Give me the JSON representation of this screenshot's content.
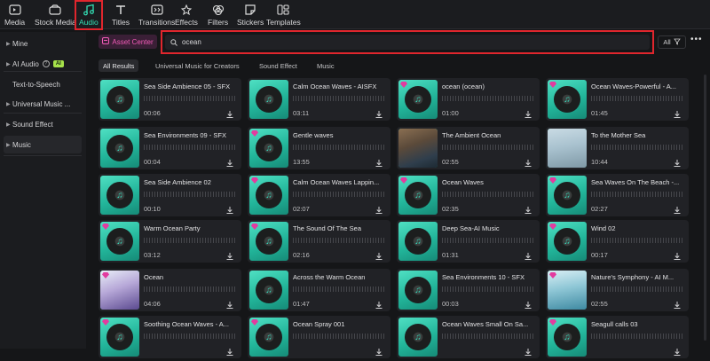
{
  "toolbar": {
    "items": [
      {
        "label": "Media",
        "icon": "media-icon"
      },
      {
        "label": "Stock Media",
        "icon": "stock-media-icon"
      },
      {
        "label": "Audio",
        "icon": "music-note-icon"
      },
      {
        "label": "Titles",
        "icon": "titles-icon"
      },
      {
        "label": "Transitions",
        "icon": "transitions-icon"
      },
      {
        "label": "Effects",
        "icon": "effects-icon"
      },
      {
        "label": "Filters",
        "icon": "filters-icon"
      },
      {
        "label": "Stickers",
        "icon": "stickers-icon"
      },
      {
        "label": "Templates",
        "icon": "templates-icon"
      }
    ],
    "active": "Audio"
  },
  "sidebar": {
    "items": [
      {
        "label": "Mine"
      },
      {
        "label": "AI Audio",
        "badge": "AI"
      },
      {
        "label": "Text-to-Speech"
      },
      {
        "label": "Universal Music ..."
      },
      {
        "label": "Sound Effect"
      },
      {
        "label": "Music"
      }
    ]
  },
  "search": {
    "asset_center": "Asset Center",
    "query": "ocean",
    "filter": "All"
  },
  "tabs": [
    "All Results",
    "Universal Music for Creators",
    "Sound Effect",
    "Music"
  ],
  "colors": {
    "accent": "#33e0b6",
    "highlight_box": "#e0262d",
    "premium_gem": "#e23b9f"
  },
  "results": [
    {
      "title": "Sea Side Ambience 05 - SFX",
      "duration": "00:06",
      "premium": false,
      "thumb": "vinyl"
    },
    {
      "title": "Calm Ocean Waves - AISFX",
      "duration": "03:11",
      "premium": false,
      "thumb": "vinyl"
    },
    {
      "title": "ocean (ocean)",
      "duration": "01:00",
      "premium": true,
      "thumb": "vinyl"
    },
    {
      "title": "Ocean Waves-Powerful - A...",
      "duration": "01:45",
      "premium": true,
      "thumb": "vinyl"
    },
    {
      "title": "Sea Environments 09 - SFX",
      "duration": "00:04",
      "premium": false,
      "thumb": "vinyl"
    },
    {
      "title": "Gentle waves",
      "duration": "13:55",
      "premium": true,
      "thumb": "vinyl"
    },
    {
      "title": "The Ambient Ocean",
      "duration": "02:55",
      "premium": false,
      "thumb": "rocks"
    },
    {
      "title": "To the Mother Sea",
      "duration": "10:44",
      "premium": false,
      "thumb": "shell"
    },
    {
      "title": "Sea Side Ambience 02",
      "duration": "00:10",
      "premium": false,
      "thumb": "vinyl"
    },
    {
      "title": "Calm Ocean Waves Lappin...",
      "duration": "02:07",
      "premium": true,
      "thumb": "vinyl"
    },
    {
      "title": "Ocean Waves",
      "duration": "02:35",
      "premium": true,
      "thumb": "vinyl"
    },
    {
      "title": "Sea Waves On The Beach -...",
      "duration": "02:27",
      "premium": true,
      "thumb": "vinyl"
    },
    {
      "title": "Warm Ocean Party",
      "duration": "03:12",
      "premium": true,
      "thumb": "vinyl"
    },
    {
      "title": "The Sound Of The Sea",
      "duration": "02:16",
      "premium": true,
      "thumb": "vinyl"
    },
    {
      "title": "Deep Sea-AI Music",
      "duration": "01:31",
      "premium": false,
      "thumb": "vinyl"
    },
    {
      "title": "Wind 02",
      "duration": "00:17",
      "premium": true,
      "thumb": "vinyl"
    },
    {
      "title": "Ocean",
      "duration": "04:06",
      "premium": true,
      "thumb": "album"
    },
    {
      "title": "Across the Warm Ocean",
      "duration": "01:47",
      "premium": false,
      "thumb": "vinyl"
    },
    {
      "title": "Sea Environments 10 - SFX",
      "duration": "00:03",
      "premium": false,
      "thumb": "vinyl"
    },
    {
      "title": "Nature's Symphony - AI M...",
      "duration": "02:55",
      "premium": true,
      "thumb": "sea"
    },
    {
      "title": "Soothing Ocean Waves - A...",
      "duration": "",
      "premium": true,
      "thumb": "vinyl"
    },
    {
      "title": "Ocean Spray 001",
      "duration": "",
      "premium": true,
      "thumb": "vinyl"
    },
    {
      "title": "Ocean Waves Small On Sa...",
      "duration": "",
      "premium": false,
      "thumb": "vinyl"
    },
    {
      "title": "Seagull calls 03",
      "duration": "",
      "premium": true,
      "thumb": "vinyl"
    }
  ]
}
